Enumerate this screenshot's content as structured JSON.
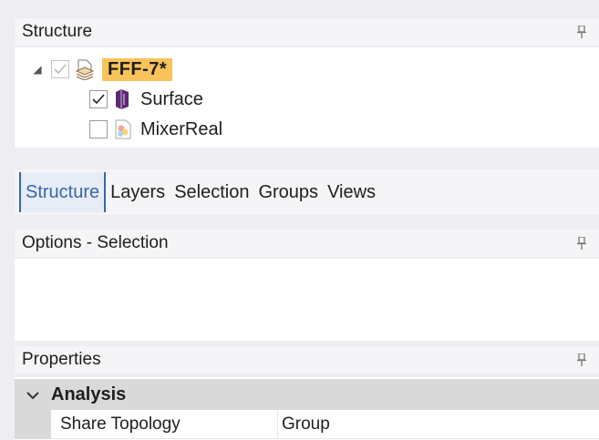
{
  "structure_pane": {
    "title": "Structure",
    "tree": {
      "root": {
        "label": "FFF-7*",
        "expanded": true,
        "checked": true,
        "icon": "design-icon"
      },
      "children": [
        {
          "label": "Surface",
          "checked": true,
          "icon": "surface-body-icon"
        },
        {
          "label": "MixerReal",
          "checked": false,
          "icon": "mixer-body-icon"
        }
      ]
    }
  },
  "tabs": {
    "items": [
      {
        "label": "Structure",
        "active": true
      },
      {
        "label": "Layers",
        "active": false
      },
      {
        "label": "Selection",
        "active": false
      },
      {
        "label": "Groups",
        "active": false
      },
      {
        "label": "Views",
        "active": false
      }
    ]
  },
  "options_pane": {
    "title": "Options - Selection"
  },
  "properties_pane": {
    "title": "Properties",
    "category": {
      "label": "Analysis",
      "expanded": true
    },
    "rows": [
      {
        "name": "Share Topology",
        "value": "Group"
      }
    ]
  },
  "colors": {
    "selection_highlight": "#f9c35b",
    "active_tab_text": "#3767a8",
    "surface_icon": "#5b2a6e"
  }
}
